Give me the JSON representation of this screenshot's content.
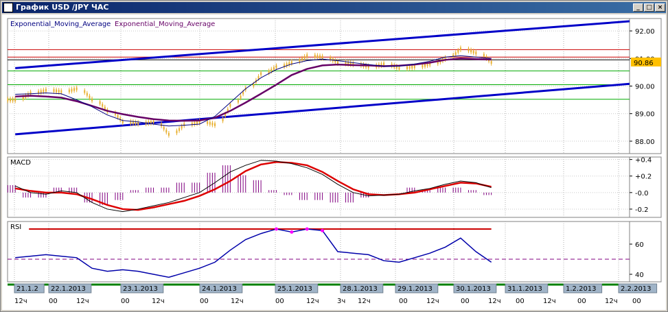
{
  "window": {
    "title": "График USD /JPY  ЧАС",
    "min_label": "_",
    "max_label": "□",
    "close_label": "×"
  },
  "chart_data": [
    {
      "type": "line",
      "panel": "price",
      "legend_left": "Exponential_Moving_Average",
      "legend_right": "Exponential_Moving_Average",
      "y_ticks": [
        88.0,
        89.0,
        90.0,
        91.0,
        92.0
      ],
      "y_tick_labels": [
        "88.00",
        "89.00",
        "90.00",
        "91.00",
        "92.00"
      ],
      "ylim": [
        87.55,
        92.45
      ],
      "current_price": 90.86,
      "current_price_label": "90.86",
      "colors": {
        "price": "#e8b030",
        "ema_fast": "#000080",
        "ema_slow": "#660066",
        "trend": "#0000c8",
        "hline_red": "#cc0000",
        "hline_green": "#00aa00",
        "hline_black": "#000000",
        "price_tag_bg": "#ffc000"
      },
      "channel_upper": [
        [
          0,
          90.65
        ],
        [
          160,
          92.35
        ]
      ],
      "channel_lower": [
        [
          0,
          88.25
        ],
        [
          160,
          90.08
        ]
      ],
      "hlines": [
        {
          "value": 91.32,
          "color": "red"
        },
        {
          "value": 91.05,
          "color": "red"
        },
        {
          "value": 90.95,
          "color": "black"
        },
        {
          "value": 90.55,
          "color": "green"
        },
        {
          "value": 90.05,
          "color": "green"
        },
        {
          "value": 89.52,
          "color": "green"
        }
      ],
      "x": [
        0,
        4,
        8,
        12,
        16,
        20,
        24,
        28,
        32,
        36,
        40,
        44,
        48,
        52,
        56,
        60,
        64,
        68,
        72,
        76,
        80,
        84,
        88,
        92,
        96,
        100,
        104,
        108,
        112,
        116,
        120,
        124
      ],
      "close": [
        89.5,
        89.75,
        89.85,
        89.8,
        89.9,
        89.5,
        89.1,
        88.7,
        88.65,
        88.7,
        88.25,
        88.6,
        88.7,
        88.6,
        89.3,
        89.9,
        90.45,
        90.7,
        90.85,
        91.1,
        91.05,
        90.85,
        90.8,
        90.7,
        90.8,
        90.65,
        90.7,
        90.8,
        91.0,
        91.35,
        91.2,
        90.86
      ],
      "ema_fast": [
        89.7,
        89.72,
        89.75,
        89.72,
        89.5,
        89.25,
        88.95,
        88.75,
        88.7,
        88.62,
        88.55,
        88.58,
        88.62,
        88.9,
        89.4,
        89.9,
        90.3,
        90.6,
        90.8,
        90.92,
        90.98,
        90.92,
        90.85,
        90.78,
        90.72,
        90.72,
        90.8,
        90.9,
        91.05,
        91.1,
        91.05,
        91.0
      ],
      "ema_slow": [
        89.62,
        89.65,
        89.62,
        89.58,
        89.45,
        89.28,
        89.1,
        88.98,
        88.88,
        88.8,
        88.75,
        88.74,
        88.75,
        88.85,
        89.1,
        89.4,
        89.72,
        90.05,
        90.4,
        90.62,
        90.75,
        90.78,
        90.76,
        90.75,
        90.72,
        90.74,
        90.78,
        90.85,
        90.95,
        91.0,
        90.98,
        90.96
      ],
      "x_range": [
        -2,
        160
      ]
    },
    {
      "type": "line",
      "panel": "macd",
      "title": "MACD",
      "y_ticks": [
        0.4,
        0.2,
        0.0,
        -0.2
      ],
      "y_tick_labels": [
        "+0.4",
        "+0.2",
        "-0.0",
        "-0.2"
      ],
      "ylim": [
        -0.3,
        0.43
      ],
      "colors": {
        "macd": "#000000",
        "signal": "#dd0000",
        "hist": "#800080"
      },
      "x": [
        0,
        4,
        8,
        12,
        16,
        20,
        24,
        28,
        32,
        36,
        40,
        44,
        48,
        52,
        56,
        60,
        64,
        68,
        72,
        76,
        80,
        84,
        88,
        92,
        96,
        100,
        104,
        108,
        112,
        116,
        120,
        124
      ],
      "macd": [
        0.08,
        0.0,
        -0.02,
        0.02,
        0.0,
        -0.12,
        -0.2,
        -0.23,
        -0.2,
        -0.16,
        -0.12,
        -0.06,
        0.0,
        0.12,
        0.25,
        0.33,
        0.39,
        0.38,
        0.35,
        0.3,
        0.22,
        0.1,
        0.0,
        -0.04,
        -0.03,
        -0.02,
        0.02,
        0.05,
        0.1,
        0.14,
        0.12,
        0.06
      ],
      "signal": [
        0.05,
        0.02,
        0.0,
        0.0,
        -0.02,
        -0.08,
        -0.15,
        -0.2,
        -0.21,
        -0.18,
        -0.14,
        -0.1,
        -0.04,
        0.04,
        0.14,
        0.26,
        0.34,
        0.37,
        0.36,
        0.33,
        0.25,
        0.14,
        0.04,
        -0.02,
        -0.03,
        -0.02,
        0.0,
        0.04,
        0.08,
        0.12,
        0.11,
        0.07
      ]
    },
    {
      "type": "line",
      "panel": "rsi",
      "title": "RSI",
      "y_ticks": [
        60,
        40
      ],
      "y_tick_labels": [
        "60",
        "40"
      ],
      "ylim": [
        35,
        75
      ],
      "upper_level": 70,
      "middle_level": 50,
      "colors": {
        "rsi": "#0000aa",
        "upper": "#cc0000",
        "middle": "#800080",
        "overbought": "#ff00ff"
      },
      "x": [
        0,
        4,
        8,
        12,
        16,
        20,
        24,
        28,
        32,
        36,
        40,
        44,
        48,
        52,
        56,
        60,
        64,
        68,
        72,
        76,
        80,
        84,
        88,
        92,
        96,
        100,
        104,
        108,
        112,
        116,
        120,
        124
      ],
      "rsi": [
        51,
        52,
        53,
        52,
        51,
        44,
        42,
        43,
        42,
        40,
        38,
        41,
        44,
        48,
        56,
        63,
        67,
        70,
        68,
        70,
        69,
        55,
        54,
        53,
        49,
        48,
        51,
        54,
        58,
        64,
        55,
        48
      ]
    }
  ],
  "date_labels": [
    {
      "x": 2,
      "label": "21.1.2"
    },
    {
      "x": 12,
      "label": "22.1.2013"
    },
    {
      "x": 33,
      "label": "23.1.2013"
    },
    {
      "x": 56,
      "label": "24.1.2013"
    },
    {
      "x": 78,
      "label": "25.1.2013"
    },
    {
      "x": 97,
      "label": "28.1.2013"
    },
    {
      "x": 113,
      "label": "29.1.2013"
    },
    {
      "x": 130,
      "label": "30.1.2013"
    },
    {
      "x": 145,
      "label": "31.1.2013"
    },
    {
      "x": 162,
      "label": "1.2.2013"
    },
    {
      "x": 178,
      "label": "2.2.2013"
    }
  ],
  "hour_labels": [
    {
      "x": 2,
      "label": "12ч"
    },
    {
      "x": 12,
      "label": "00"
    },
    {
      "x": 20,
      "label": "12ч"
    },
    {
      "x": 33,
      "label": "00"
    },
    {
      "x": 42,
      "label": "12ч"
    },
    {
      "x": 56,
      "label": "00"
    },
    {
      "x": 65,
      "label": "12ч"
    },
    {
      "x": 78,
      "label": "00"
    },
    {
      "x": 87,
      "label": "12ч"
    },
    {
      "x": 96,
      "label": "3ч"
    },
    {
      "x": 102,
      "label": "12ч"
    },
    {
      "x": 114,
      "label": "00"
    },
    {
      "x": 122,
      "label": "12ч"
    },
    {
      "x": 132,
      "label": "00"
    },
    {
      "x": 140,
      "label": "12ч"
    },
    {
      "x": 148,
      "label": "00"
    },
    {
      "x": 156,
      "label": "12ч"
    },
    {
      "x": 166,
      "label": "00"
    },
    {
      "x": 174,
      "label": "12ч"
    },
    {
      "x": 182,
      "label": "00"
    }
  ]
}
